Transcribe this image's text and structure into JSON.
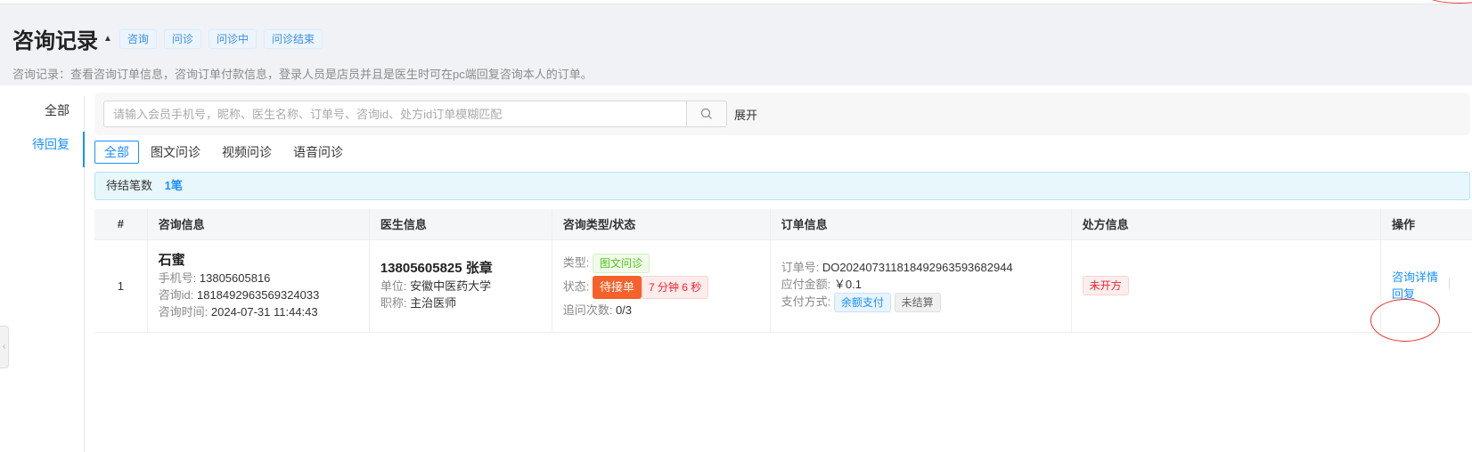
{
  "header": {
    "title": "咨询记录",
    "tags": [
      "咨询",
      "问诊",
      "问诊中",
      "问诊结束"
    ],
    "description": "咨询记录：查看咨询订单信息，咨询订单付款信息，登录人员是店员并且是医生时可在pc端回复咨询本人的订单。"
  },
  "sidebar": {
    "items": [
      {
        "label": "全部"
      },
      {
        "label": "待回复"
      }
    ]
  },
  "search": {
    "placeholder": "请输入会员手机号，昵称、医生名称、订单号、咨询id、处方id订单模糊匹配",
    "expand_label": "展开"
  },
  "tabs": [
    {
      "label": "全部"
    },
    {
      "label": "图文问诊"
    },
    {
      "label": "视频问诊"
    },
    {
      "label": "语音问诊"
    }
  ],
  "info": {
    "label": "待结笔数",
    "count": "1笔"
  },
  "table": {
    "headers": [
      "#",
      "咨询信息",
      "医生信息",
      "咨询类型/状态",
      "订单信息",
      "处方信息",
      "操作"
    ],
    "rows": [
      {
        "index": "1",
        "patient": {
          "name": "石蜜",
          "phone_label": "手机号:",
          "phone": "13805605816",
          "id_label": "咨询id:",
          "id": "1818492963569324033",
          "time_label": "咨询时间:",
          "time": "2024-07-31 11:44:43"
        },
        "doctor": {
          "title": "13805605825 张章",
          "unit_label": "单位:",
          "unit": "安徽中医药大学",
          "position_label": "职称:",
          "position": "主治医师"
        },
        "consult": {
          "type_label": "类型:",
          "type": "图文问诊",
          "status_label": "状态:",
          "status": "待接单",
          "countdown": "7 分钟 6 秒",
          "followup_label": "追问次数:",
          "followup": "0/3"
        },
        "order": {
          "no_label": "订单号:",
          "no": "DO2024073118184929635936829​44",
          "amount_label": "应付金额:",
          "amount": "￥0.1",
          "pay_label": "支付方式:",
          "pay_method": "余额支付",
          "settle_status": "未结算"
        },
        "prescription": {
          "status": "未开方"
        },
        "actions": {
          "detail": "咨询详情",
          "reply": "回复"
        }
      }
    ]
  },
  "colors": {
    "primary": "#1890ff",
    "danger": "#f5222d",
    "warning": "#f5612b",
    "success": "#52c41a"
  }
}
